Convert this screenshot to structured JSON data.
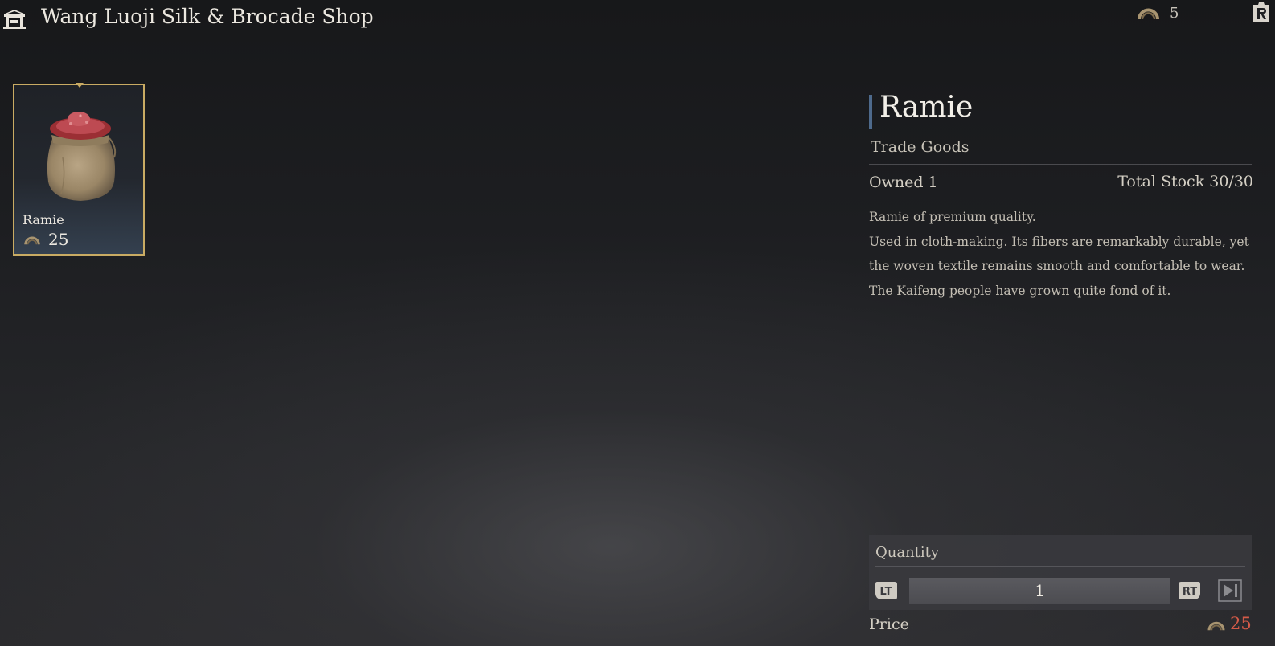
{
  "header": {
    "shop_name": "Wang Luoji Silk & Brocade Shop",
    "currency_amount": "5",
    "icons": [
      "shop-icon",
      "currency-coin-icon",
      "r-button-icon"
    ]
  },
  "item_list": [
    {
      "name": "Ramie",
      "price": "25",
      "icon": "ramie-sack-icon",
      "selected": true
    }
  ],
  "detail": {
    "name": "Ramie",
    "category": "Trade Goods",
    "owned": "Owned 1",
    "stock": "Total Stock 30/30",
    "description": [
      "Ramie of premium quality.",
      "Used in cloth-making. Its fibers are remarkably durable, yet",
      "the woven textile remains smooth and comfortable to wear.",
      "The Kaifeng people have grown quite fond of it."
    ]
  },
  "purchase": {
    "quantity_label": "Quantity",
    "quantity_value": "1",
    "decrease_button": "LT",
    "increase_button": "RT",
    "price_label": "Price",
    "price_value": "25"
  },
  "colors": {
    "card_border": "#c9ab63",
    "title_accent": "#4e6a8c",
    "price_red": "#d35a48"
  }
}
